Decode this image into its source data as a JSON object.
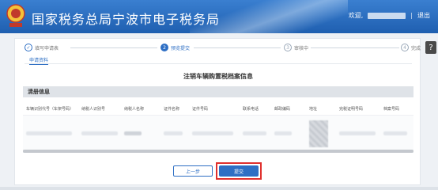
{
  "header": {
    "site_title": "国家税务总局宁波市电子税务局",
    "welcome": "欢迎,",
    "separator": "|",
    "logout": "退出",
    "brand_color": "#1f5fb0"
  },
  "help": {
    "icon": "question-icon",
    "label": "?"
  },
  "stepper": {
    "steps": [
      {
        "num": "✓",
        "label": "填写申请表",
        "state": "done"
      },
      {
        "num": "2",
        "label": "预览提交",
        "state": "active"
      },
      {
        "num": "3",
        "label": "审核中",
        "state": "pending"
      },
      {
        "num": "4",
        "label": "完成",
        "state": "pending"
      }
    ],
    "subtab": "申请资料"
  },
  "page_title": "注销车辆购置税档案信息",
  "section_title": "清册信息",
  "table": {
    "headers": [
      "车辆识别代号（车架号码）",
      "纳税人识别号",
      "纳税人名称",
      "证件名称",
      "证件号码",
      "联系电话",
      "邮政编码",
      "地址",
      "完税证明号码",
      "档案号码"
    ]
  },
  "buttons": {
    "prev": "上一步",
    "submit": "提交"
  },
  "accent_color": "#2e6fc4",
  "highlight_color": "#e0302d"
}
